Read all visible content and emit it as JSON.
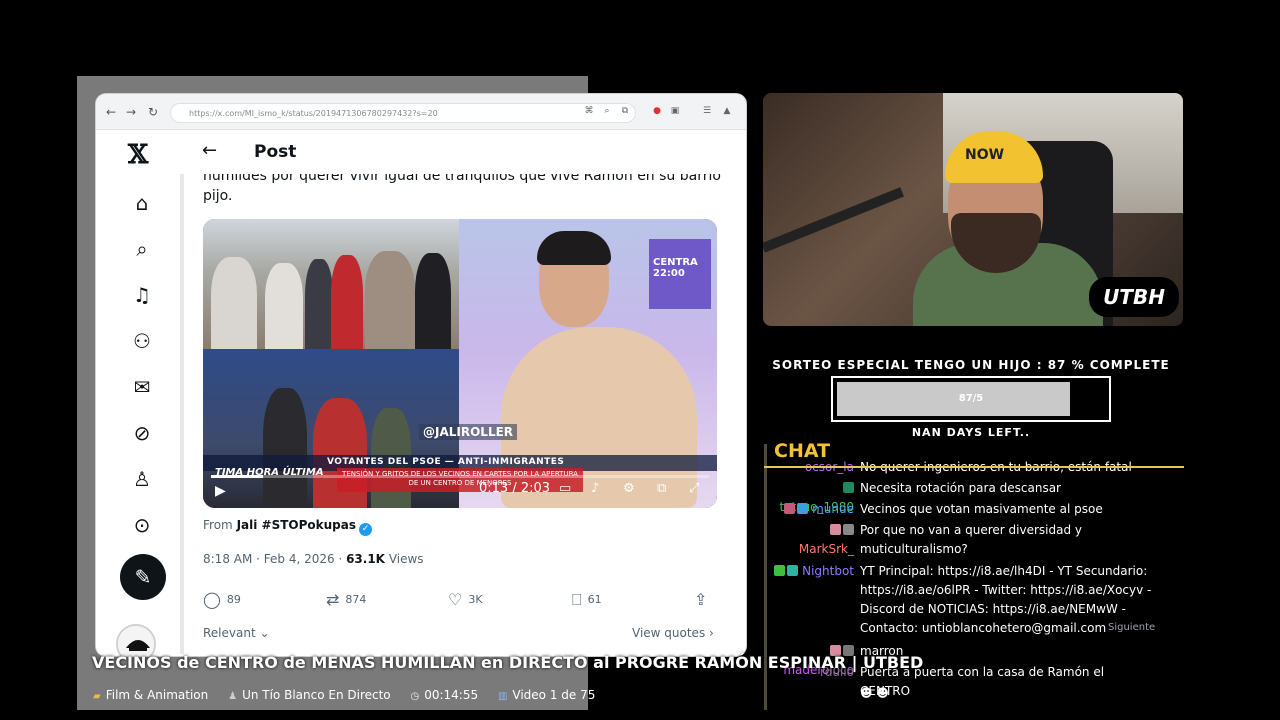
{
  "browser": {
    "url": "https://x.com/MI_ismo_k/status/2019471306780297432?s=20",
    "controls": {
      "back": "←",
      "forward": "→",
      "reload": "↻"
    }
  },
  "x": {
    "logo": "𝕏",
    "nav_icons": [
      "home-icon",
      "search-icon",
      "notifications-icon",
      "follow-icon",
      "messages-icon",
      "grok-icon",
      "profile-icon",
      "more-icon"
    ],
    "compose_icon": "✎"
  },
  "post": {
    "header": "Post",
    "text_line1": "humildes por querer vivir igual de tranquilos que vive Ramón en su barrio",
    "text_line2": "pijo.",
    "video": {
      "studio_screen": "CENTRA 22:00",
      "watermark": "@JALIROLLER",
      "ticker": "VOTANTES DEL PSOE  —  ANTI-INMIGRANTES",
      "ticker_red": "TENSIÓN Y GRITOS DE LOS VECINOS EN CARTES POR LA APERTURA DE UN CENTRO DE MENORES",
      "ticker_left": "TIMA HORA  ÚLTIMA",
      "time": "0:13 / 2:03",
      "progress": 0.105
    },
    "from_prefix": "From",
    "from_name": "Jali #STOPokupas",
    "timestamp": "8:18 AM · Feb 4, 2026 · ",
    "views_count": "63.1K",
    "views_label": "Views",
    "replies": "89",
    "reposts": "874",
    "likes": "3K",
    "bookmarks": "61",
    "relevant": "Relevant ⌄",
    "view_quotes": "View quotes ›"
  },
  "webcam": {
    "beanie_text": "NOW",
    "badge": "UTBH"
  },
  "subathon": {
    "title": "SORTEO ESPECIAL TENGO UN HIJO :  87 % COMPLETE",
    "progress": 0.87,
    "bar_text": "87/5",
    "days": "NAN DAYS LEFT.."
  },
  "chat": {
    "title": "CHAT",
    "messages": [
      {
        "user": "ocsor_la",
        "color": "#b56cff",
        "text": "No querer ingenieros en tu barrio, están fatal"
      },
      {
        "user": "tetsuo_1980",
        "color": "#35c46b",
        "text": "Necesita rotación para descansar"
      },
      {
        "user": "munue",
        "color": "#4da6ff",
        "text": "Vecinos que votan masivamente al psoe"
      },
      {
        "user": "MarkSrk_",
        "color": "#ff7b6b",
        "text": "Por que no van a querer diversidad y muticulturalismo?"
      },
      {
        "user": "Nightbot",
        "color": "#8a7bff",
        "text": "YT Principal: https://i8.ae/lh4DI - YT Secundario: https://i8.ae/o6lPR - Twitter: https://i8.ae/Xocyv - Discord de NOTICIAS: https://i8.ae/NEMwW - Contacto: untioblancohetero@gmail.com"
      },
      {
        "user": "maderoloco",
        "color": "#d25cff",
        "text": "marron"
      },
      {
        "user": "rdullo",
        "color": "#7a7a7a",
        "text": "Puerta a puerta con la casa de Ramón el CENTRO"
      }
    ]
  },
  "next_label": "Siguiente",
  "overlay": {
    "title": "VECINOS de CENTRO de MENAS HUMILLAN en DIRECTO al PROGRE RAMÓN ESPINAR | UTBED",
    "category": "Film & Animation",
    "channel": "Un Tío Blanco En Directo",
    "duration": "00:14:55",
    "position": "Video 1 de 75"
  }
}
